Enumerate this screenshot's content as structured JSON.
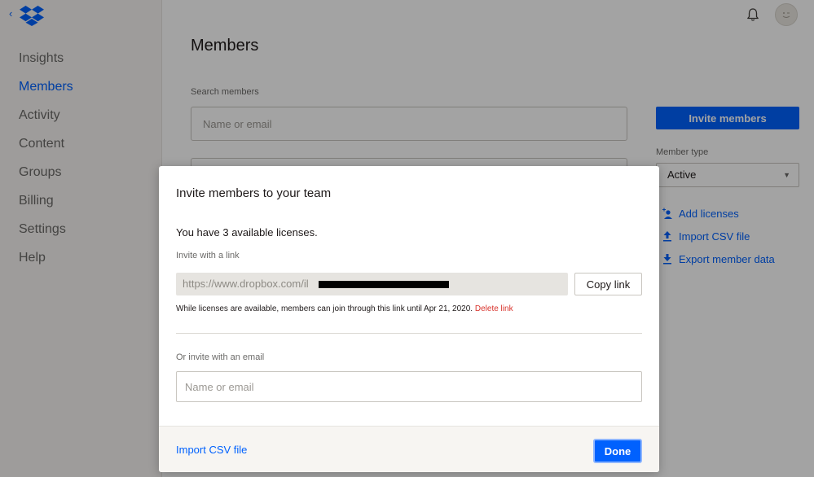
{
  "sidebar": {
    "back_glyph": "‹",
    "logo_icon": "dropbox-logo",
    "items": [
      {
        "label": "Insights"
      },
      {
        "label": "Members"
      },
      {
        "label": "Activity"
      },
      {
        "label": "Content"
      },
      {
        "label": "Groups"
      },
      {
        "label": "Billing"
      },
      {
        "label": "Settings"
      },
      {
        "label": "Help"
      }
    ],
    "active_index": 1
  },
  "header": {
    "bell_icon": "bell-icon",
    "avatar_icon": "avatar"
  },
  "main": {
    "title": "Members",
    "search_label": "Search members",
    "search_placeholder": "Name or email",
    "invite_button": "Invite members",
    "member_type_label": "Member type",
    "member_type_value": "Active",
    "actions": [
      {
        "label": "Add licenses",
        "icon": "add-person-icon"
      },
      {
        "label": "Import CSV file",
        "icon": "upload-icon"
      },
      {
        "label": "Export member data",
        "icon": "download-icon"
      }
    ]
  },
  "modal": {
    "title": "Invite members to your team",
    "licenses_text": "You have 3 available licenses.",
    "link_label": "Invite with a link",
    "link_value": "https://www.dropbox.com/il",
    "copy_button": "Copy link",
    "link_note": "While licenses are available, members can join through this link until Apr 21, 2020.",
    "delete_link": "Delete link",
    "email_label": "Or invite with an email",
    "email_placeholder": "Name or email",
    "footer_import": "Import CSV file",
    "done_button": "Done"
  },
  "colors": {
    "accent": "#0061fe",
    "danger": "#d8322b",
    "sidebar_bg": "#f7f5f2",
    "overlay": "rgba(0,0,0,0.36)"
  }
}
